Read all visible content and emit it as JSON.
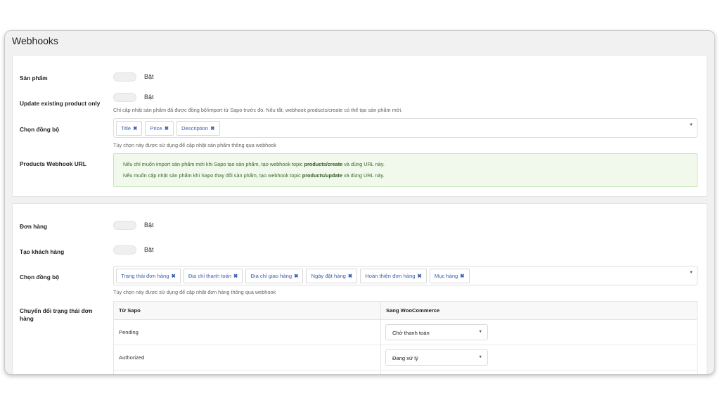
{
  "page": {
    "title": "Webhooks"
  },
  "products": {
    "product_label": "Sản phẩm",
    "product_toggle": "Bật",
    "update_label": "Update existing product only",
    "update_toggle": "Bật",
    "update_help": "Chỉ cập nhật sản phẩm đã được đồng bộ/import từ Sapo trước đó. Nếu tắt, webhook products/create có thể tạo sản phẩm mới.",
    "sync_label": "Chọn đồng bộ",
    "sync_tags": [
      "Title",
      "Price",
      "Description"
    ],
    "sync_help": "Tùy chọn này được sử dụng để cập nhật sản phẩm thông qua webhook",
    "url_label": "Products Webhook URL",
    "alert_line1_pre": "Nếu chỉ muốn import sản phẩm mới khi Sapo tạo sản phẩm, tạo webhook topic ",
    "alert_line1_bold": "products/create",
    "alert_line1_post": " và dùng URL này.",
    "alert_line2_pre": "Nếu muốn cập nhật sản phẩm khi Sapo thay đổi sản phẩm, tạo webhook topic ",
    "alert_line2_bold": "products/update",
    "alert_line2_post": " và dùng URL này."
  },
  "orders": {
    "order_label": "Đơn hàng",
    "order_toggle": "Bật",
    "customer_label": "Tạo khách hàng",
    "customer_toggle": "Bật",
    "sync_label": "Chọn đồng bộ",
    "sync_tags": [
      "Trạng thái đơn hàng",
      "Địa chỉ thanh toán",
      "Địa chỉ giao hàng",
      "Ngày đặt hàng",
      "Hoàn thiện đơn hàng",
      "Mục hàng"
    ],
    "sync_help": "Tùy chọn này được sử dụng để cập nhật đơn hàng thông qua webhook",
    "status_label": "Chuyển đổi trạng thái đơn hàng",
    "table": {
      "col_from": "Từ Sapo",
      "col_to": "Sang WooCommerce",
      "rows": [
        {
          "from": "Pending",
          "to": "Chờ thanh toán"
        },
        {
          "from": "Authorized",
          "to": "Đang xử lý"
        }
      ]
    }
  },
  "icons": {
    "remove": "✖",
    "caret": "▼"
  }
}
